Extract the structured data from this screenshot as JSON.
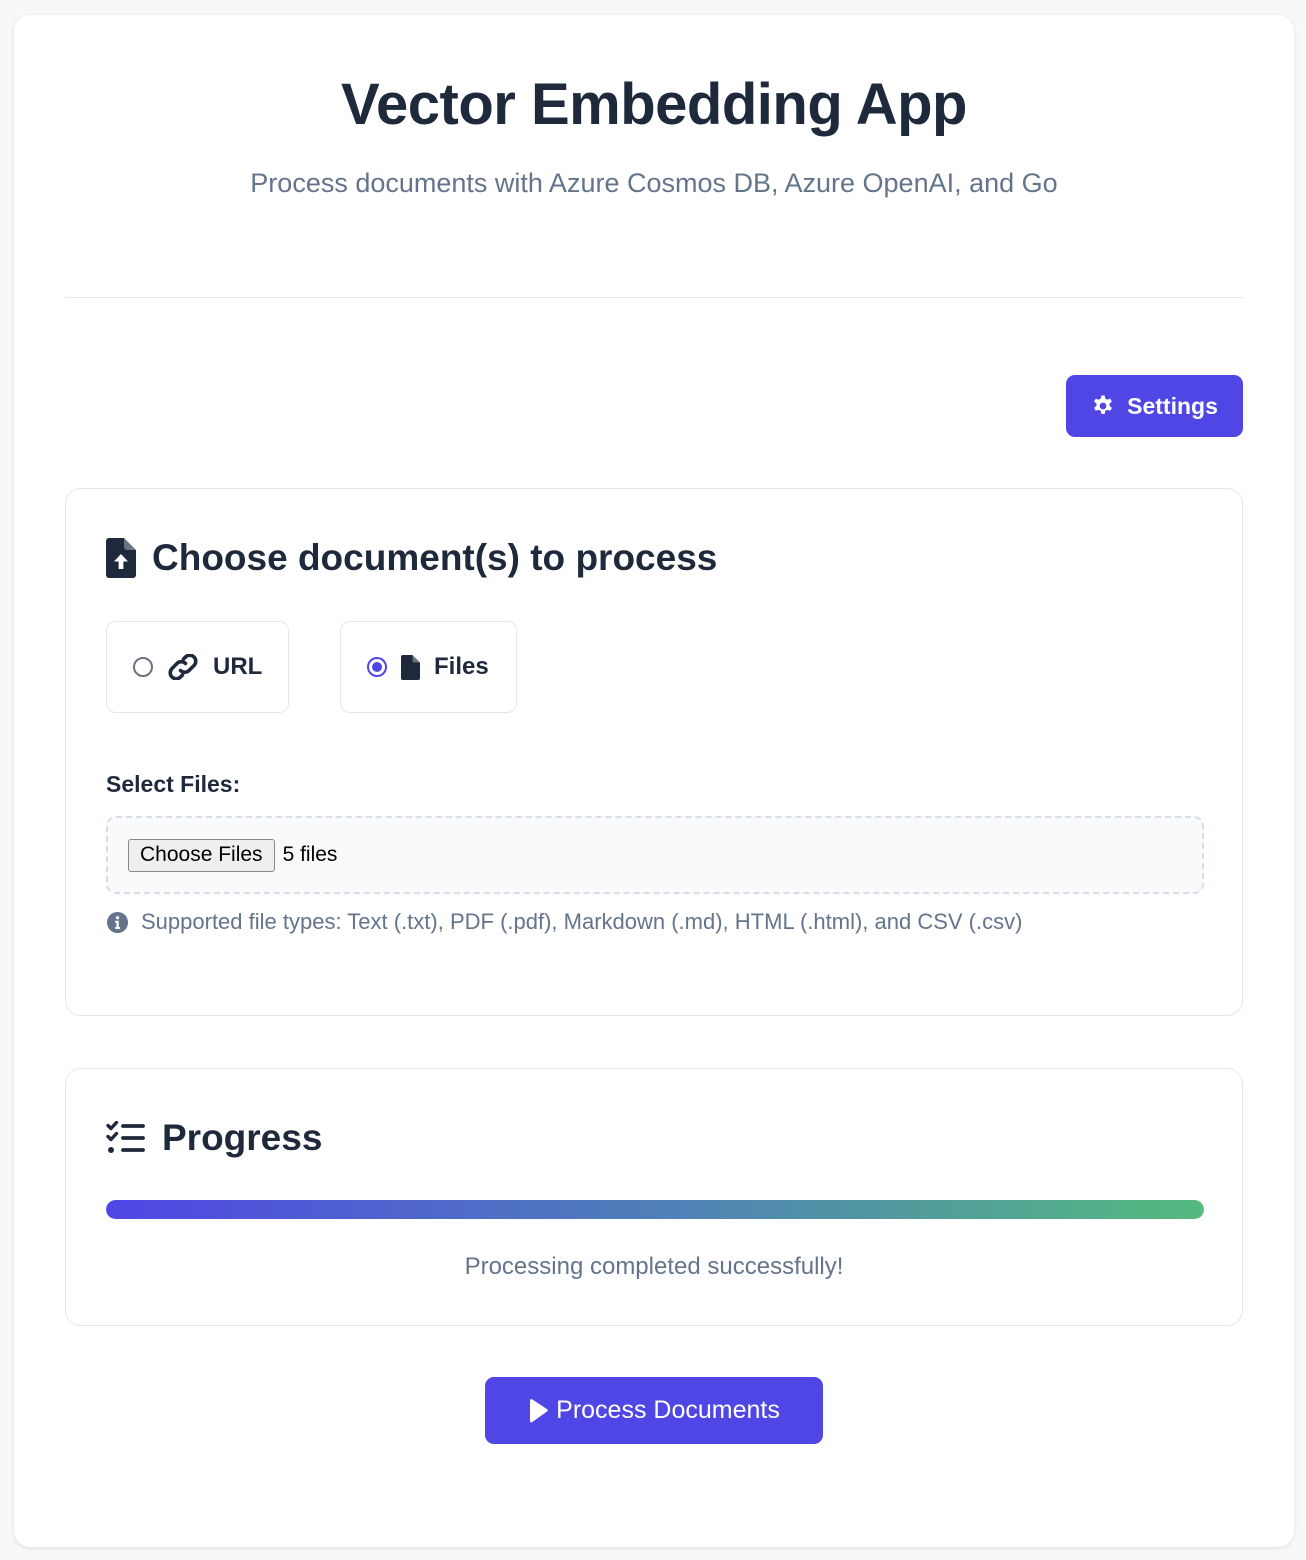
{
  "header": {
    "title": "Vector Embedding App",
    "subtitle": "Process documents with Azure Cosmos DB, Azure OpenAI, and Go"
  },
  "toolbar": {
    "settings_label": "Settings",
    "settings_icon": "gear-icon"
  },
  "document_section": {
    "title": "Choose document(s) to process",
    "title_icon": "file-upload-icon",
    "source_options": [
      {
        "label": "URL",
        "icon": "link-icon",
        "selected": false
      },
      {
        "label": "Files",
        "icon": "file-icon",
        "selected": true
      }
    ],
    "files_field": {
      "label": "Select Files:",
      "button_label": "Choose Files",
      "selection_text": "5 files"
    },
    "help_text": "Supported file types: Text (.txt), PDF (.pdf), Markdown (.md), HTML (.html), and CSV (.csv)",
    "help_icon": "info-icon"
  },
  "progress_section": {
    "title": "Progress",
    "title_icon": "list-check-icon",
    "progress_percent": 100,
    "status_text": "Processing completed successfully!"
  },
  "actions": {
    "process_label": "Process Documents",
    "process_icon": "play-icon"
  },
  "colors": {
    "accent": "#4f46e5",
    "progress_start": "#4f46e5",
    "progress_end": "#54ba7e",
    "heading": "#1e293b",
    "muted": "#64748b"
  }
}
